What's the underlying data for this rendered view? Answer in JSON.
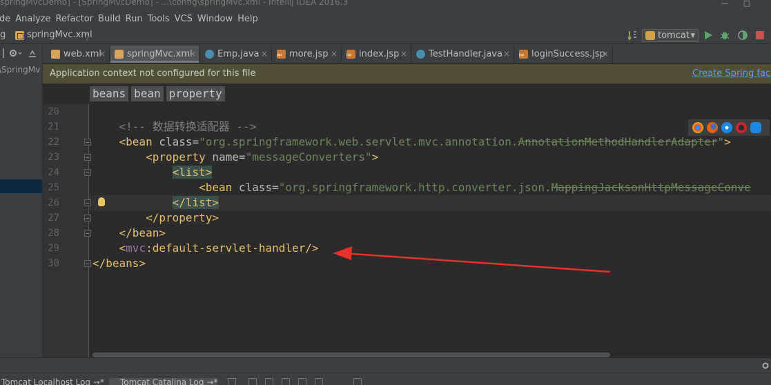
{
  "window": {
    "title": "springMvcDemo] - [SpringMvcDemo] - ...\\config\\springMvc.xml - IntelliJ IDEA 2016.3",
    "min": "—",
    "max": "□"
  },
  "menu": [
    "de",
    "Analyze",
    "Refactor",
    "Build",
    "Run",
    "Tools",
    "VCS",
    "Window",
    "Help"
  ],
  "navbar": {
    "crumb_prefix": "g",
    "file_crumb": "springMvc.xml",
    "crumb_sep": "〉",
    "run_config": "tomcat",
    "run_config_caret": "▾"
  },
  "project_panel": {
    "path_text": "\\SpringMv"
  },
  "tabs": [
    {
      "label": "web.xml",
      "icon": "xml-file-icon"
    },
    {
      "label": "springMvc.xml",
      "icon": "xml-file-icon",
      "active": true
    },
    {
      "label": "Emp.java",
      "icon": "java-class-icon"
    },
    {
      "label": "more.jsp",
      "icon": "jsp-file-icon"
    },
    {
      "label": "index.jsp",
      "icon": "jsp-file-icon"
    },
    {
      "label": "TestHandler.java",
      "icon": "java-class-icon"
    },
    {
      "label": "loginSuccess.jsp",
      "icon": "jsp-file-icon"
    }
  ],
  "tab_close_glyph": "×",
  "banner": {
    "message": "Application context not configured for this file",
    "action": "Create Spring facet"
  },
  "breadcrumbs": [
    "beans",
    "bean",
    "property"
  ],
  "editor": {
    "line_numbers": [
      "20",
      "21",
      "22",
      "23",
      "24",
      "25",
      "26",
      "27",
      "28",
      "29",
      "30"
    ],
    "comment": "<!-- 数据转换适配器 -->",
    "l22": {
      "open": "<bean ",
      "attr": "class=",
      "val": "\"org.springframework.web.servlet.mvc.annotation.",
      "dep": "AnnotationMethodHandlerAdapter",
      "close_q": "\"",
      "close": ">"
    },
    "l23": {
      "open": "<property ",
      "attr": "name=",
      "val": "\"messageConverters\"",
      "close": ">"
    },
    "l24": "<list>",
    "l25": {
      "open": "<bean ",
      "attr": "class=",
      "val": "\"org.springframework.http.converter.json.",
      "dep": "MappingJacksonHttpMessageConve"
    },
    "l26": "</list>",
    "l27": "</property>",
    "l28": "</bean>",
    "l29": {
      "open": "<",
      "ns": "mvc",
      "rest": ":default-servlet-handler/>"
    },
    "l30": "</beans>"
  },
  "bottom_tabs": [
    "Tomcat Localhost Log",
    "Tomcat Catalina Log"
  ],
  "bottom_tab_suffix": "→*",
  "colors": {
    "editor_bg": "#2b2b2b",
    "tag": "#e8bf6a",
    "string": "#6a8759",
    "comment": "#808080",
    "namespace": "#9876aa",
    "banner_bg": "#534f34",
    "link": "#589df6",
    "arrow": "#e8302a"
  }
}
